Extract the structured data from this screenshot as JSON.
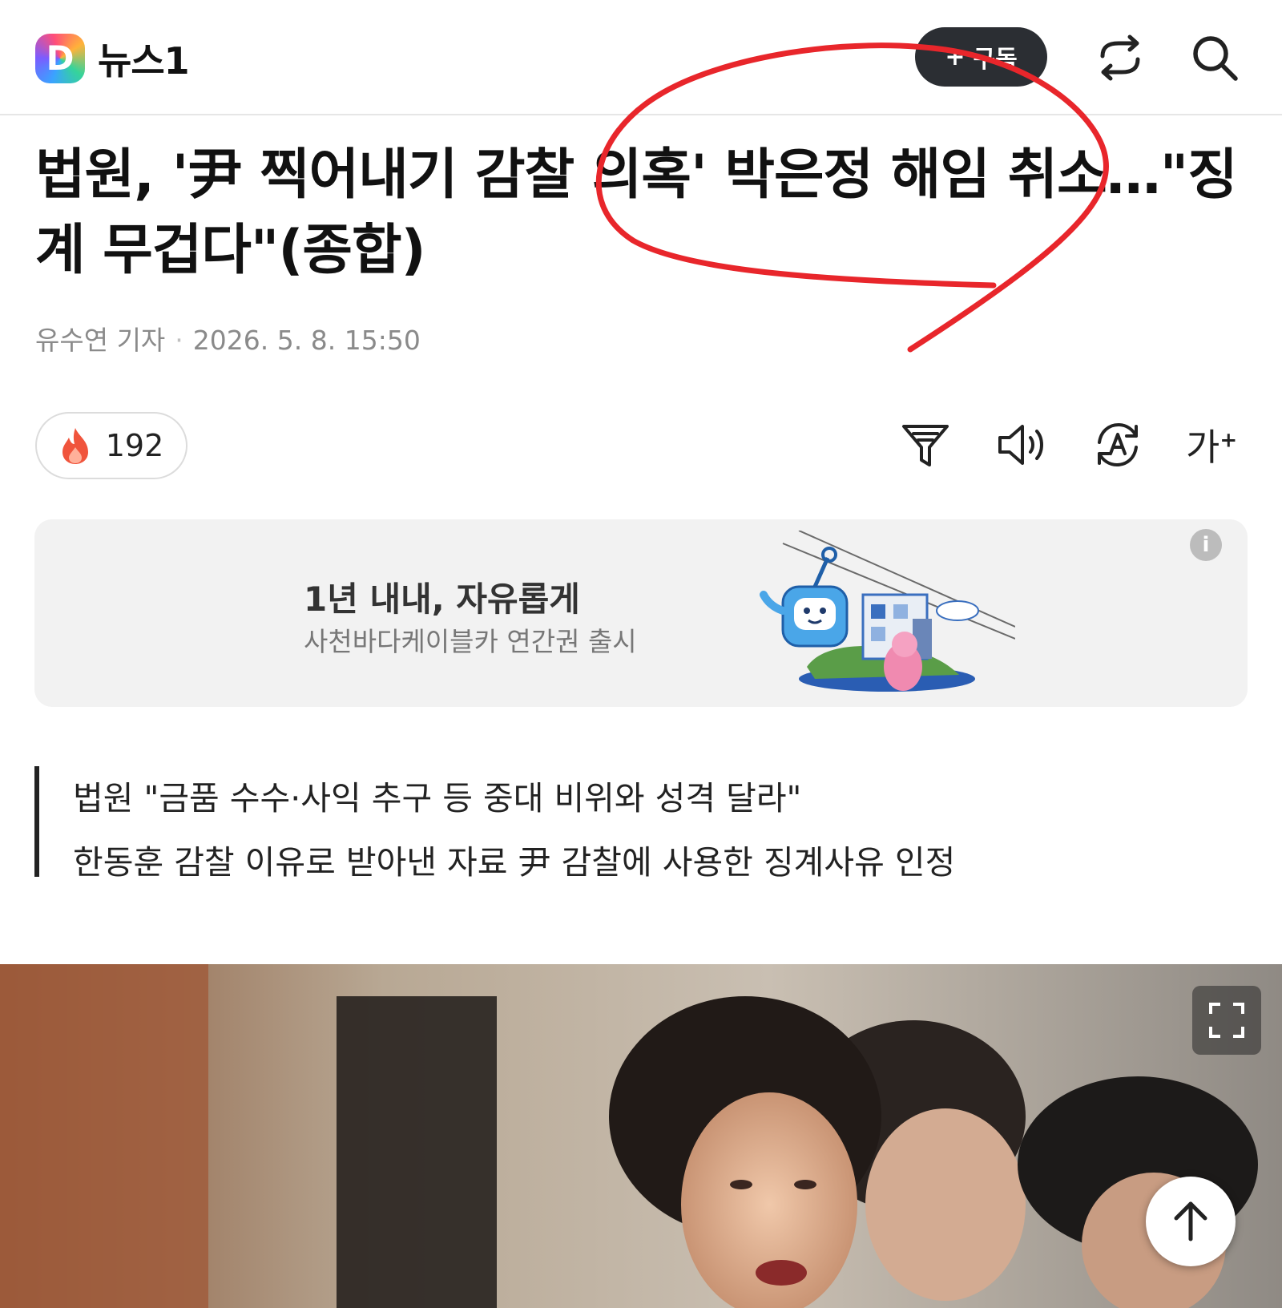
{
  "header": {
    "logo_letter": "D",
    "brand": "뉴스1",
    "subscribe_plus": "+",
    "subscribe_label": "구독",
    "icons": [
      "share-icon",
      "search-icon"
    ]
  },
  "article": {
    "headline": "법원, '尹 찍어내기 감찰 의혹' 박은정 해임 취소…\"징계 무겁다\"(종합)",
    "reporter": "유수연 기자",
    "separator": "·",
    "datetime": "2026. 5. 8. 15:50",
    "reaction_count": "192",
    "tools": [
      "summary-icon",
      "speaker-icon",
      "translate-icon",
      "font-size-icon"
    ],
    "font_size_label": "가",
    "font_size_plus": "+",
    "summary_lines": [
      "법원 \"금품 수수·사익 추구 등 중대 비위와 성격 달라\"",
      "한동훈 감찰 이유로 받아낸 자료 尹 감찰에 사용한 징계사유 인정"
    ]
  },
  "ad": {
    "title": "1년 내내, 자유롭게",
    "subtitle": "사천바다케이블카 연간권 출시",
    "info": "i"
  },
  "colors": {
    "subscribe_bg": "#2b2e33",
    "annotation_red": "#e8262b",
    "ad_bg": "#f2f2f2",
    "flame": "#f0543c"
  }
}
